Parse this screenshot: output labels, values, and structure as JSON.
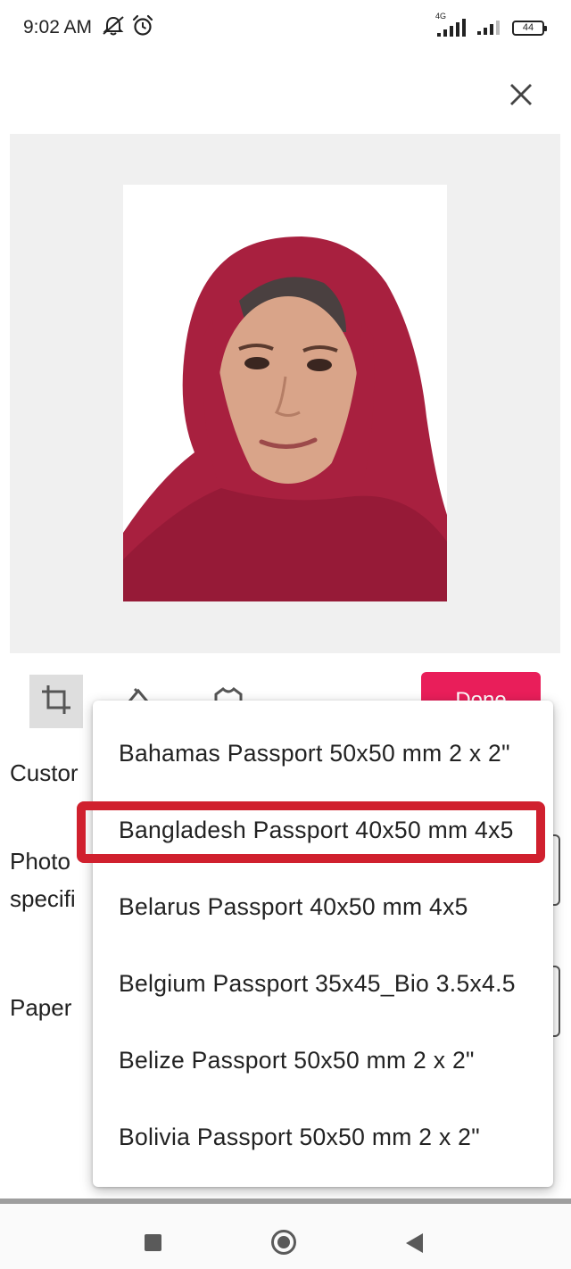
{
  "status_bar": {
    "time": "9:02 AM",
    "network_label": "4G",
    "battery_level": "44"
  },
  "form": {
    "custom_label": "Custor",
    "photo_spec_label_line1": "Photo",
    "photo_spec_label_line2": "specifi",
    "paper_label": "Paper"
  },
  "toolbar": {
    "done_label": "Done"
  },
  "dropdown": {
    "items": [
      "Bahamas Passport 50x50 mm 2 x 2\"",
      "Bangladesh Passport 40x50 mm 4x5",
      "Belarus Passport 40x50 mm 4x5",
      "Belgium Passport 35x45_Bio 3.5x4.5",
      "Belize Passport 50x50 mm 2 x 2\"",
      "Bolivia Passport 50x50 mm 2 x 2\""
    ],
    "highlighted_index": 1
  },
  "colors": {
    "accent": "#e91e5a",
    "highlight_box": "#d0202e",
    "preview_bg": "#f0f0f0",
    "hijab": "#a8203f"
  },
  "icons": {
    "close": "close-icon",
    "crop": "crop-icon",
    "fill": "fill-bucket-icon",
    "shirt": "shirt-icon",
    "alarm": "alarm-icon",
    "mute": "notifications-off-icon"
  }
}
